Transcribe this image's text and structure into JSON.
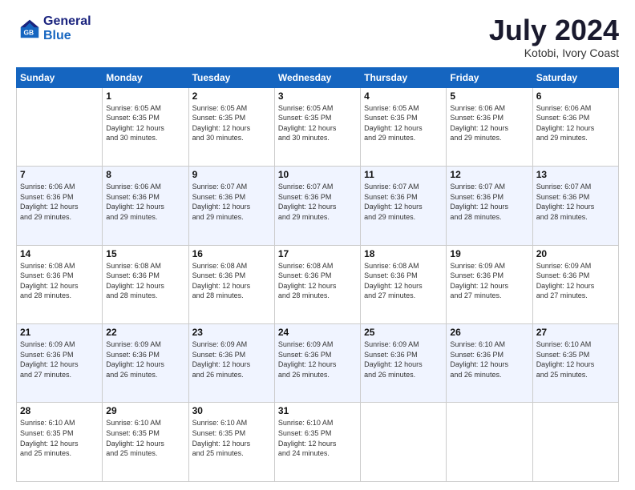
{
  "header": {
    "logo_line1": "General",
    "logo_line2": "Blue",
    "month": "July 2024",
    "location": "Kotobi, Ivory Coast"
  },
  "days_of_week": [
    "Sunday",
    "Monday",
    "Tuesday",
    "Wednesday",
    "Thursday",
    "Friday",
    "Saturday"
  ],
  "weeks": [
    [
      {
        "num": "",
        "empty": true
      },
      {
        "num": "1",
        "sunrise": "6:05 AM",
        "sunset": "6:35 PM",
        "daylight": "12 hours and 30 minutes."
      },
      {
        "num": "2",
        "sunrise": "6:05 AM",
        "sunset": "6:35 PM",
        "daylight": "12 hours and 30 minutes."
      },
      {
        "num": "3",
        "sunrise": "6:05 AM",
        "sunset": "6:35 PM",
        "daylight": "12 hours and 30 minutes."
      },
      {
        "num": "4",
        "sunrise": "6:05 AM",
        "sunset": "6:35 PM",
        "daylight": "12 hours and 29 minutes."
      },
      {
        "num": "5",
        "sunrise": "6:06 AM",
        "sunset": "6:36 PM",
        "daylight": "12 hours and 29 minutes."
      },
      {
        "num": "6",
        "sunrise": "6:06 AM",
        "sunset": "6:36 PM",
        "daylight": "12 hours and 29 minutes."
      }
    ],
    [
      {
        "num": "7",
        "sunrise": "6:06 AM",
        "sunset": "6:36 PM",
        "daylight": "12 hours and 29 minutes."
      },
      {
        "num": "8",
        "sunrise": "6:06 AM",
        "sunset": "6:36 PM",
        "daylight": "12 hours and 29 minutes."
      },
      {
        "num": "9",
        "sunrise": "6:07 AM",
        "sunset": "6:36 PM",
        "daylight": "12 hours and 29 minutes."
      },
      {
        "num": "10",
        "sunrise": "6:07 AM",
        "sunset": "6:36 PM",
        "daylight": "12 hours and 29 minutes."
      },
      {
        "num": "11",
        "sunrise": "6:07 AM",
        "sunset": "6:36 PM",
        "daylight": "12 hours and 29 minutes."
      },
      {
        "num": "12",
        "sunrise": "6:07 AM",
        "sunset": "6:36 PM",
        "daylight": "12 hours and 28 minutes."
      },
      {
        "num": "13",
        "sunrise": "6:07 AM",
        "sunset": "6:36 PM",
        "daylight": "12 hours and 28 minutes."
      }
    ],
    [
      {
        "num": "14",
        "sunrise": "6:08 AM",
        "sunset": "6:36 PM",
        "daylight": "12 hours and 28 minutes."
      },
      {
        "num": "15",
        "sunrise": "6:08 AM",
        "sunset": "6:36 PM",
        "daylight": "12 hours and 28 minutes."
      },
      {
        "num": "16",
        "sunrise": "6:08 AM",
        "sunset": "6:36 PM",
        "daylight": "12 hours and 28 minutes."
      },
      {
        "num": "17",
        "sunrise": "6:08 AM",
        "sunset": "6:36 PM",
        "daylight": "12 hours and 28 minutes."
      },
      {
        "num": "18",
        "sunrise": "6:08 AM",
        "sunset": "6:36 PM",
        "daylight": "12 hours and 27 minutes."
      },
      {
        "num": "19",
        "sunrise": "6:09 AM",
        "sunset": "6:36 PM",
        "daylight": "12 hours and 27 minutes."
      },
      {
        "num": "20",
        "sunrise": "6:09 AM",
        "sunset": "6:36 PM",
        "daylight": "12 hours and 27 minutes."
      }
    ],
    [
      {
        "num": "21",
        "sunrise": "6:09 AM",
        "sunset": "6:36 PM",
        "daylight": "12 hours and 27 minutes."
      },
      {
        "num": "22",
        "sunrise": "6:09 AM",
        "sunset": "6:36 PM",
        "daylight": "12 hours and 26 minutes."
      },
      {
        "num": "23",
        "sunrise": "6:09 AM",
        "sunset": "6:36 PM",
        "daylight": "12 hours and 26 minutes."
      },
      {
        "num": "24",
        "sunrise": "6:09 AM",
        "sunset": "6:36 PM",
        "daylight": "12 hours and 26 minutes."
      },
      {
        "num": "25",
        "sunrise": "6:09 AM",
        "sunset": "6:36 PM",
        "daylight": "12 hours and 26 minutes."
      },
      {
        "num": "26",
        "sunrise": "6:10 AM",
        "sunset": "6:36 PM",
        "daylight": "12 hours and 26 minutes."
      },
      {
        "num": "27",
        "sunrise": "6:10 AM",
        "sunset": "6:35 PM",
        "daylight": "12 hours and 25 minutes."
      }
    ],
    [
      {
        "num": "28",
        "sunrise": "6:10 AM",
        "sunset": "6:35 PM",
        "daylight": "12 hours and 25 minutes."
      },
      {
        "num": "29",
        "sunrise": "6:10 AM",
        "sunset": "6:35 PM",
        "daylight": "12 hours and 25 minutes."
      },
      {
        "num": "30",
        "sunrise": "6:10 AM",
        "sunset": "6:35 PM",
        "daylight": "12 hours and 25 minutes."
      },
      {
        "num": "31",
        "sunrise": "6:10 AM",
        "sunset": "6:35 PM",
        "daylight": "12 hours and 24 minutes."
      },
      {
        "num": "",
        "empty": true
      },
      {
        "num": "",
        "empty": true
      },
      {
        "num": "",
        "empty": true
      }
    ]
  ],
  "labels": {
    "sunrise": "Sunrise:",
    "sunset": "Sunset:",
    "daylight": "Daylight:"
  }
}
